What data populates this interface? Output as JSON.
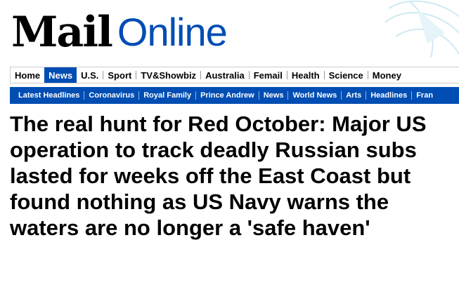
{
  "masthead": {
    "logo_mail": "Mail",
    "logo_online": "Online",
    "colors": {
      "brand_blue": "#004db3",
      "logo_black": "#000000"
    }
  },
  "nav": {
    "primary": [
      {
        "label": "Home",
        "active": false
      },
      {
        "label": "News",
        "active": true
      },
      {
        "label": "U.S.",
        "active": false
      },
      {
        "label": "Sport",
        "active": false
      },
      {
        "label": "TV&Showbiz",
        "active": false
      },
      {
        "label": "Australia",
        "active": false
      },
      {
        "label": "Femail",
        "active": false
      },
      {
        "label": "Health",
        "active": false
      },
      {
        "label": "Science",
        "active": false
      },
      {
        "label": "Money",
        "active": false
      }
    ],
    "secondary": [
      {
        "label": "Latest Headlines"
      },
      {
        "label": "Coronavirus"
      },
      {
        "label": "Royal Family"
      },
      {
        "label": "Prince Andrew"
      },
      {
        "label": "News"
      },
      {
        "label": "World News"
      },
      {
        "label": "Arts"
      },
      {
        "label": "Headlines"
      },
      {
        "label": "Fran"
      }
    ]
  },
  "article": {
    "headline": "The real hunt for Red October: Major US operation to track deadly Russian subs lasted for weeks off the East Coast but found nothing as US Navy warns the waters are no longer a 'safe haven'"
  }
}
